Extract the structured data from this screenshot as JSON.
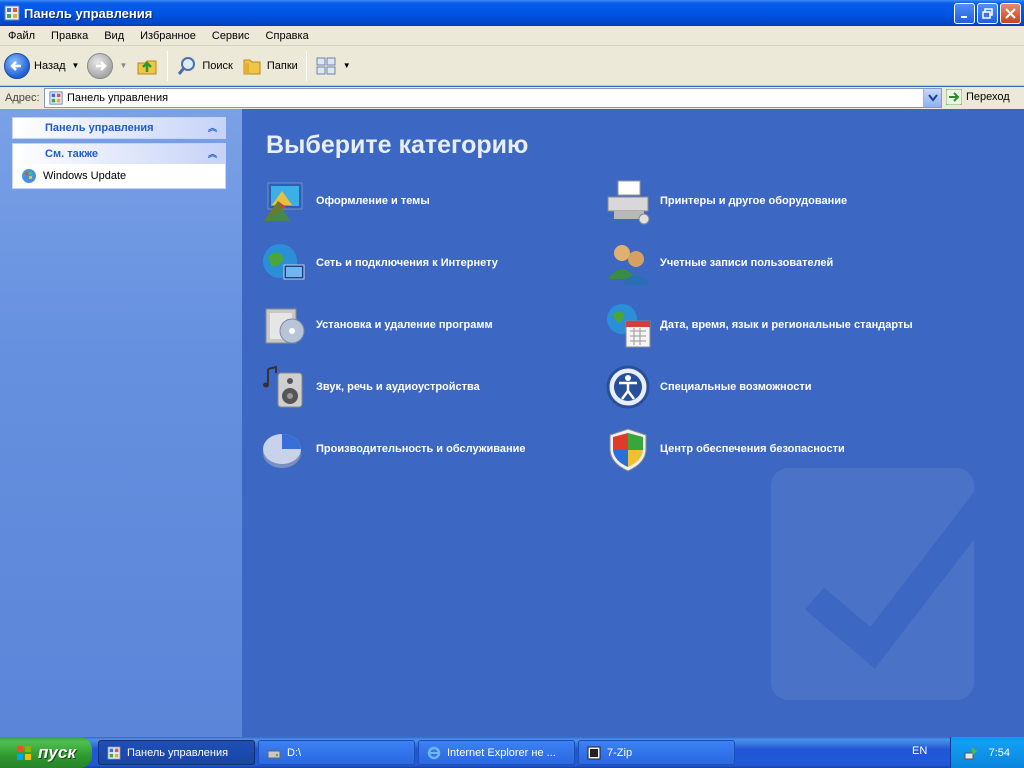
{
  "window": {
    "title": "Панель управления"
  },
  "menu": [
    "Файл",
    "Правка",
    "Вид",
    "Избранное",
    "Сервис",
    "Справка"
  ],
  "toolbar": {
    "back_label": "Назад",
    "search_label": "Поиск",
    "folders_label": "Папки"
  },
  "address": {
    "label": "Адрес:",
    "value": "Панель управления",
    "go_label": "Переход"
  },
  "left_panel": {
    "control_panel_title": "Панель управления",
    "see_also_title": "См. также",
    "see_also_items": [
      "Windows Update"
    ]
  },
  "main": {
    "heading": "Выберите категорию",
    "categories_left": [
      "Оформление и темы",
      "Сеть и подключения к Интернету",
      "Установка и удаление программ",
      "Звук, речь и аудиоустройства",
      "Производительность и обслуживание"
    ],
    "categories_right": [
      "Принтеры и другое оборудование",
      "Учетные записи пользователей",
      "Дата, время, язык и региональные стандарты",
      "Специальные возможности",
      "Центр обеспечения безопасности"
    ]
  },
  "taskbar": {
    "start_label": "пуск",
    "tasks": [
      "Панель управления",
      "D:\\",
      "Internet Explorer не ...",
      "7-Zip"
    ],
    "language": "EN",
    "clock": "7:54"
  }
}
